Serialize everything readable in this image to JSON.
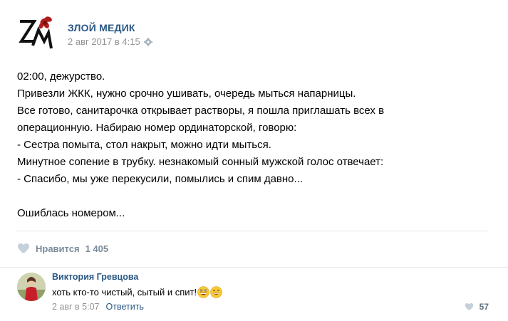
{
  "post": {
    "author": "ЗЛОЙ МЕДИК",
    "date": "2 авг 2017 в 4:15",
    "lines": [
      "02:00, дежурство.",
      "Привезли ЖКК, нужно срочно ушивать, очередь мыться напарницы.",
      "Все готово, санитарочка открывает растворы, я пошла приглашать всех в",
      "операционную. Набираю номер ординаторской, говорю:",
      "- Сестра помыта, стол накрыт, можно идти мыться.",
      "Минутное сопение в трубку. незнакомый сонный мужской голос отвечает:",
      "- Спасибо, мы уже перекусили, помылись и спим давно...",
      "",
      "Ошиблась номером..."
    ],
    "likes_label": "Нравится",
    "likes_count": "1 405"
  },
  "comment": {
    "author": "Виктория Гревцова",
    "text": "хоть кто-то чистый, сытый и спит!",
    "date": "2 авг в 5:07",
    "reply_label": "Ответить",
    "likes": "57"
  },
  "icons": {
    "logo": "zm-logo-icon",
    "settings": "gear-icon",
    "like": "heart-icon",
    "emoji_1": "grinning-face-icon",
    "emoji_2": "smiling-face-icon"
  },
  "colors": {
    "link": "#2a5885",
    "meta": "#939393",
    "like_gray": "#c5d0db",
    "logo_red": "#b01c1c"
  }
}
